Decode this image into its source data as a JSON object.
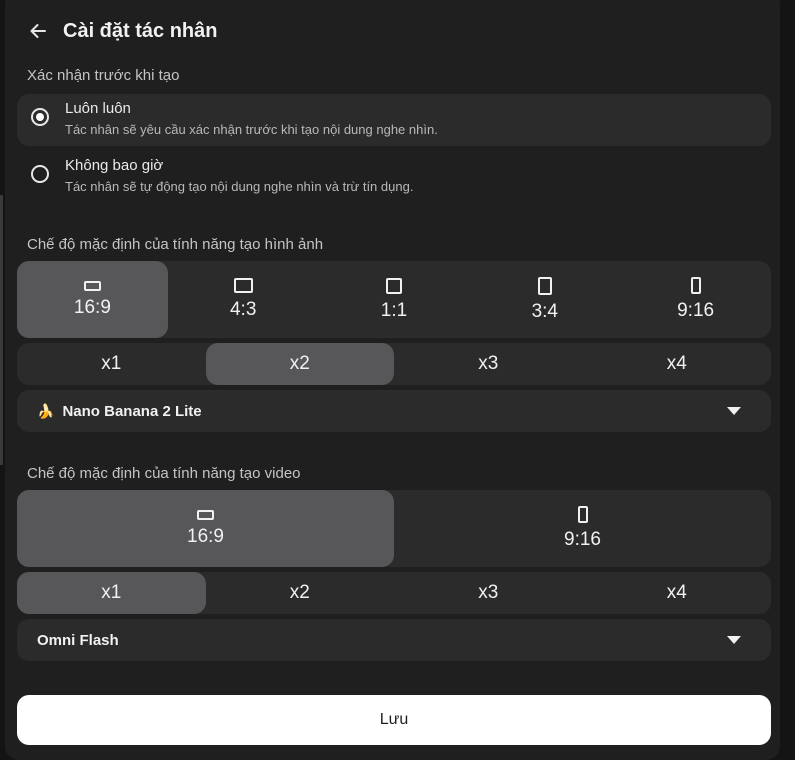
{
  "header": {
    "title": "Cài đặt tác nhân"
  },
  "confirm": {
    "label": "Xác nhận trước khi tạo",
    "options": [
      {
        "title": "Luôn luôn",
        "desc": "Tác nhân sẽ yêu cầu xác nhận trước khi tạo nội dung nghe nhìn.",
        "selected": true
      },
      {
        "title": "Không bao giờ",
        "desc": "Tác nhân sẽ tự động tạo nội dung nghe nhìn và trừ tín dụng.",
        "selected": false
      }
    ]
  },
  "image": {
    "label": "Chế độ mặc định của tính năng tạo hình ảnh",
    "ratios": [
      "16:9",
      "4:3",
      "1:1",
      "3:4",
      "9:16"
    ],
    "selected_ratio": "16:9",
    "counts": [
      "x1",
      "x2",
      "x3",
      "x4"
    ],
    "selected_count": "x2",
    "model_icon": "🍌",
    "model": "Nano Banana 2 Lite"
  },
  "video": {
    "label": "Chế độ mặc định của tính năng tạo video",
    "ratios": [
      "16:9",
      "9:16"
    ],
    "selected_ratio": "16:9",
    "counts": [
      "x1",
      "x2",
      "x3",
      "x4"
    ],
    "selected_count": "x1",
    "model": "Omni Flash"
  },
  "save_label": "Lưu",
  "colors": {
    "panel": "#1f1f20",
    "control": "#2b2b2c",
    "active": "#57575a",
    "text": "#f1f1f1"
  }
}
